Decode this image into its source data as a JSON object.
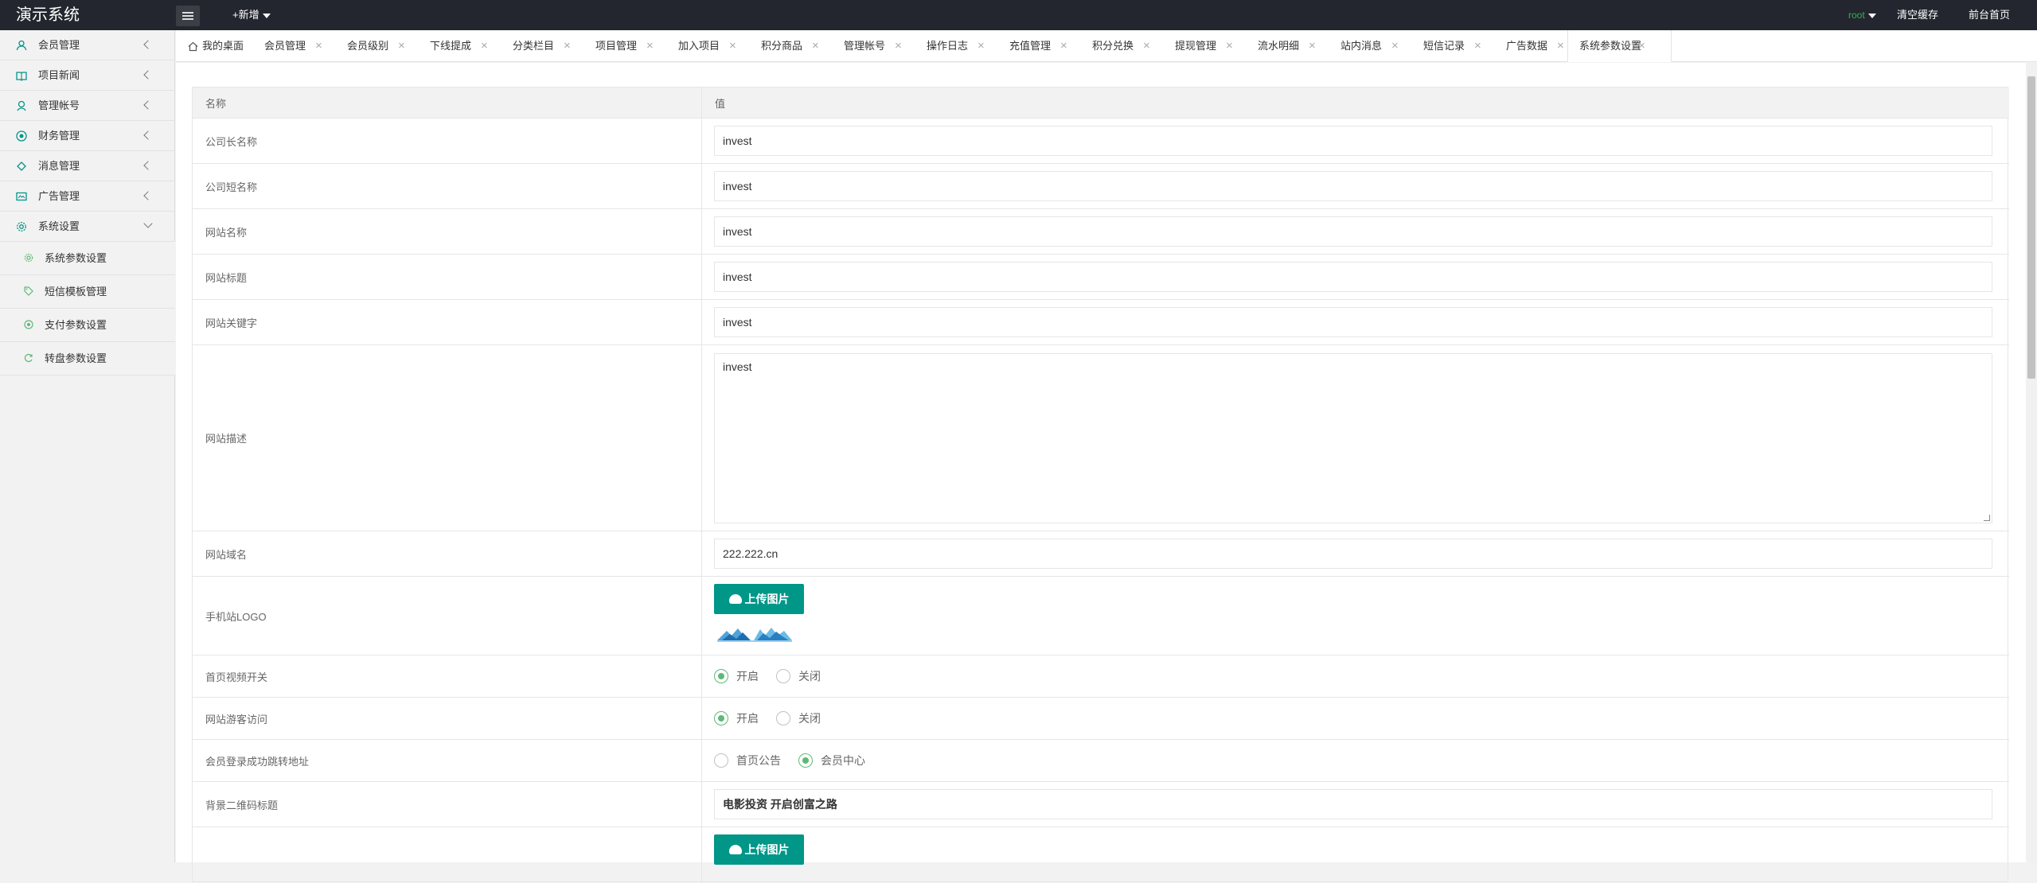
{
  "app": {
    "title": "演示系统",
    "new_label": "+新增"
  },
  "topbar": {
    "user": "root",
    "clear_cache": "清空缓存",
    "frontend_home": "前台首页"
  },
  "sidebar": {
    "items": [
      {
        "label": "会员管理",
        "icon": "user-icon"
      },
      {
        "label": "项目新闻",
        "icon": "book-icon"
      },
      {
        "label": "管理帐号",
        "icon": "admin-icon"
      },
      {
        "label": "财务管理",
        "icon": "finance-icon"
      },
      {
        "label": "消息管理",
        "icon": "message-icon"
      },
      {
        "label": "广告管理",
        "icon": "ad-icon"
      },
      {
        "label": "系统设置",
        "icon": "gear-icon"
      }
    ],
    "sub_items": [
      {
        "label": "系统参数设置",
        "icon": "gear-icon"
      },
      {
        "label": "短信模板管理",
        "icon": "tag-icon"
      },
      {
        "label": "支付参数设置",
        "icon": "pay-icon"
      },
      {
        "label": "转盘参数设置",
        "icon": "wheel-icon"
      }
    ]
  },
  "tabs": {
    "home": "我的桌面",
    "items": [
      "会员管理",
      "会员级别",
      "下线提成",
      "分类栏目",
      "项目管理",
      "加入项目",
      "积分商品",
      "管理帐号",
      "操作日志",
      "充值管理",
      "积分兑换",
      "提现管理",
      "流水明细",
      "站内消息",
      "短信记录",
      "广告数据",
      "系统参数设置"
    ],
    "close": "×"
  },
  "table": {
    "header_name": "名称",
    "header_value": "值",
    "rows": {
      "company_long": {
        "label": "公司长名称",
        "value": "invest"
      },
      "company_short": {
        "label": "公司短名称",
        "value": "invest"
      },
      "site_name": {
        "label": "网站名称",
        "value": "invest"
      },
      "site_title": {
        "label": "网站标题",
        "value": "invest"
      },
      "site_keywords": {
        "label": "网站关键字",
        "value": "invest"
      },
      "site_desc": {
        "label": "网站描述",
        "value": "invest"
      },
      "site_domain": {
        "label": "网站域名",
        "value": "222.222.cn"
      },
      "mobile_logo": {
        "label": "手机站LOGO",
        "upload": "上传图片"
      },
      "home_video": {
        "label": "首页视频开关",
        "options": [
          "开启",
          "关闭"
        ],
        "selected": "开启"
      },
      "guest_access": {
        "label": "网站游客访问",
        "options": [
          "开启",
          "关闭"
        ],
        "selected": "开启"
      },
      "login_redirect": {
        "label": "会员登录成功跳转地址",
        "options": [
          "首页公告",
          "会员中心"
        ],
        "selected": "会员中心"
      },
      "qr_title": {
        "label": "背景二维码标题",
        "value": "电影投资 开启创富之路"
      },
      "qr_bg": {
        "upload": "上传图片"
      }
    }
  },
  "colors": {
    "topbar": "#23262e",
    "accent": "#009688",
    "radio_on": "#5fb878",
    "user": "#2eb05a"
  }
}
